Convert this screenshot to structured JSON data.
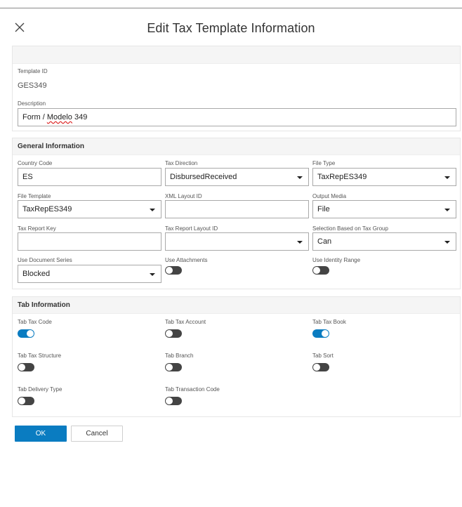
{
  "dialog": {
    "title": "Edit Tax Template Information"
  },
  "identity": {
    "template_id_label": "Template ID",
    "template_id_value": "GES349",
    "description_label": "Description",
    "description_prefix": "Form / ",
    "description_misspelled": "Modelo",
    "description_suffix": " 349"
  },
  "general": {
    "header": "General Information",
    "country_code": {
      "label": "Country Code",
      "value": "ES"
    },
    "tax_direction": {
      "label": "Tax Direction",
      "value": "DisbursedReceived"
    },
    "file_type": {
      "label": "File Type",
      "value": "TaxRepES349"
    },
    "file_template": {
      "label": "File Template",
      "value": "TaxRepES349"
    },
    "xml_layout_id": {
      "label": "XML Layout ID",
      "value": ""
    },
    "output_media": {
      "label": "Output Media",
      "value": "File"
    },
    "tax_report_key": {
      "label": "Tax Report Key",
      "value": ""
    },
    "tax_report_layout_id": {
      "label": "Tax Report Layout ID",
      "value": ""
    },
    "selection_based": {
      "label": "Selection Based on Tax Group",
      "value": "Can"
    },
    "use_document_series": {
      "label": "Use Document Series",
      "value": "Blocked"
    },
    "use_attachments": {
      "label": "Use Attachments",
      "on": false
    },
    "use_identity_range": {
      "label": "Use Identity Range",
      "on": false
    }
  },
  "tabs": {
    "header": "Tab Information",
    "tab_tax_code": {
      "label": "Tab Tax Code",
      "on": true
    },
    "tab_tax_account": {
      "label": "Tab Tax Account",
      "on": false
    },
    "tab_tax_book": {
      "label": "Tab Tax Book",
      "on": true
    },
    "tab_tax_structure": {
      "label": "Tab Tax Structure",
      "on": false
    },
    "tab_branch": {
      "label": "Tab Branch",
      "on": false
    },
    "tab_sort": {
      "label": "Tab Sort",
      "on": false
    },
    "tab_delivery_type": {
      "label": "Tab Delivery Type",
      "on": false
    },
    "tab_transaction_code": {
      "label": "Tab Transaction Code",
      "on": false
    }
  },
  "buttons": {
    "ok": "OK",
    "cancel": "Cancel"
  },
  "colors": {
    "accent": "#0a7cc1",
    "toggle_off": "#444444"
  }
}
